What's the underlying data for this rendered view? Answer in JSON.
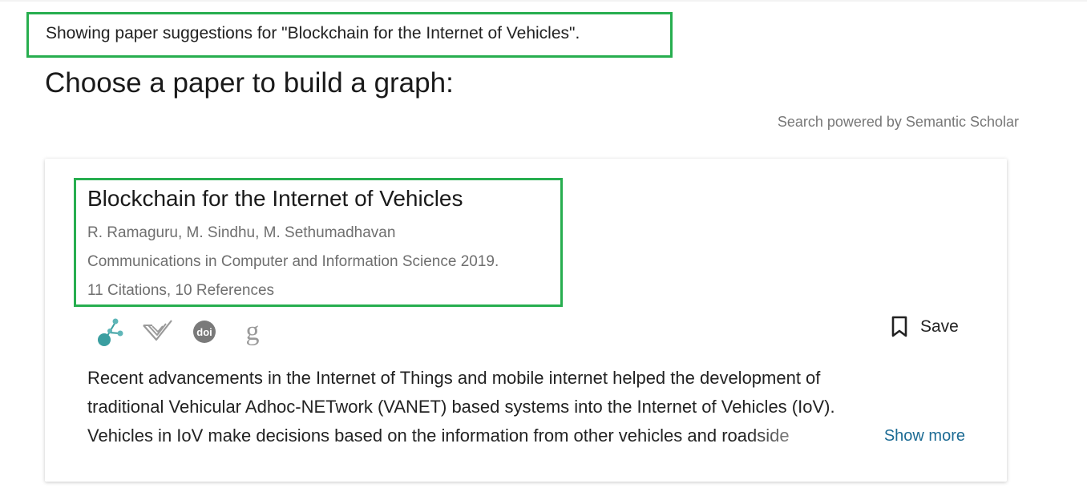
{
  "suggestion": {
    "text": "Showing paper suggestions for \"Blockchain for the Internet of Vehicles\"."
  },
  "heading": "Choose a paper to build a graph:",
  "powered_by": "Search powered by Semantic Scholar",
  "paper": {
    "title": "Blockchain for the Internet of Vehicles",
    "authors": "R. Ramaguru, M. Sindhu, M. Sethumadhavan",
    "venue_year": "Communications in Computer and Information Science 2019.",
    "citations": "11 Citations, 10 References",
    "links": [
      {
        "icon": "connected-papers-icon",
        "color": "#3a9ea0"
      },
      {
        "icon": "semantic-scholar-icon",
        "color": "#9a9a9a"
      },
      {
        "icon": "doi-icon",
        "label": "doi",
        "color": "#7a7a7a"
      },
      {
        "icon": "google-scholar-icon",
        "label": "g",
        "color": "#9a9a9a"
      }
    ],
    "save_label": "Save",
    "abstract_lines": [
      "Recent advancements in the Internet of Things and mobile internet helped the development of",
      "traditional Vehicular Adhoc-NETwork (VANET) based systems into the Internet of Vehicles (IoV).",
      "Vehicles in IoV make decisions based on the information from other vehicles and roadside"
    ],
    "show_more_label": "Show more"
  },
  "colors": {
    "highlight_border": "#27ae4f",
    "link": "#1c6b94",
    "muted_text": "#6f6f6f"
  }
}
